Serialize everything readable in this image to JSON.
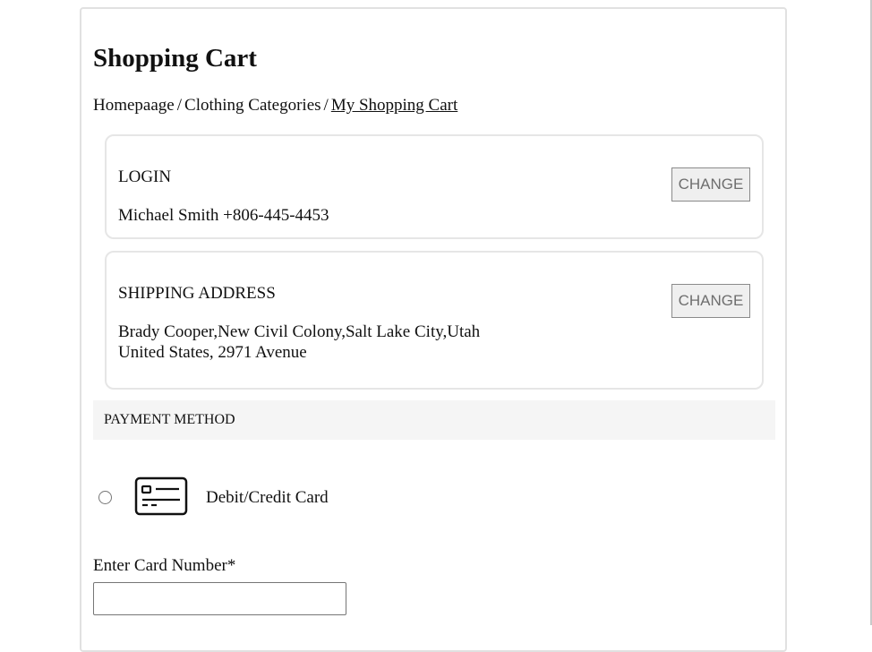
{
  "page": {
    "title": "Shopping Cart"
  },
  "breadcrumb": {
    "items": [
      "Homepaage",
      "Clothing Categories",
      "My Shopping Cart"
    ],
    "separator": "/"
  },
  "login": {
    "heading": "LOGIN",
    "details": "Michael Smith +806-445-4453",
    "change_label": "CHANGE"
  },
  "shipping": {
    "heading": "SHIPPING ADDRESS",
    "address_line1": "Brady Cooper,New Civil Colony,Salt Lake City,Utah",
    "address_line2": "United States, 2971 Avenue",
    "change_label": "CHANGE"
  },
  "payment": {
    "heading": "PAYMENT METHOD",
    "options": [
      {
        "label": "Debit/Credit Card",
        "icon": "credit-card-icon",
        "selected": false
      }
    ],
    "card_number_label": "Enter Card Number*",
    "card_number_value": ""
  },
  "colors": {
    "section_bg": "#f5f5f5",
    "card_border": "#e6e6e6",
    "button_bg": "#efefef",
    "button_text": "#6e6e6e"
  }
}
